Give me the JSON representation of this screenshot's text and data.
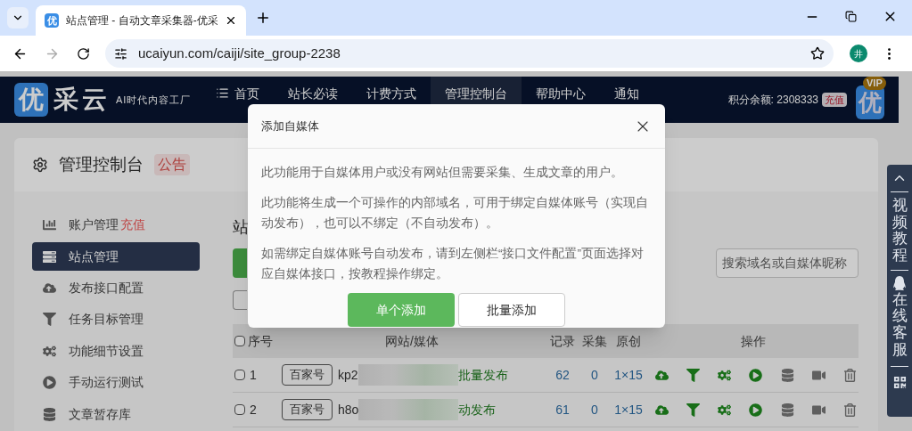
{
  "browser": {
    "tab_title": "站点管理 - 自动文章采集器-优采",
    "url": "ucaiyun.com/caiji/site_group-2238",
    "profile": "井"
  },
  "header": {
    "favicon": "优",
    "logo_mark": "优",
    "logo_text": "采云",
    "slogan": "AI时代内容工厂",
    "nav": [
      {
        "label": "首页",
        "selected": false
      },
      {
        "label": "站长必读",
        "selected": false
      },
      {
        "label": "计费方式",
        "selected": false
      },
      {
        "label": "管理控制台",
        "selected": true
      },
      {
        "label": "帮助中心",
        "selected": false
      },
      {
        "label": "通知",
        "selected": false
      }
    ],
    "balance": "积分余额: 2308333",
    "recharge": "充值",
    "avatar": "优",
    "vip": "VIP"
  },
  "page": {
    "title": "管理控制台",
    "notice": "公告"
  },
  "sidebar": [
    {
      "label": "账户管理",
      "badge": "充值",
      "selected": false
    },
    {
      "label": "站点管理",
      "selected": true
    },
    {
      "label": "发布接口配置",
      "selected": false
    },
    {
      "label": "任务目标管理",
      "selected": false
    },
    {
      "label": "功能细节设置",
      "selected": false
    },
    {
      "label": "手动运行测试",
      "selected": false
    },
    {
      "label": "文章暂存库",
      "selected": false
    }
  ],
  "panel": {
    "heading": "站",
    "search": {
      "placeholder": "搜索域名或自媒体昵称"
    }
  },
  "table": {
    "select_all_checked": false,
    "columns": [
      "序号",
      "网站/媒体",
      "记录",
      "采集",
      "原创",
      "操作"
    ],
    "rows": [
      {
        "checked": false,
        "no": "1",
        "platform": "百家号",
        "domain": "kp2",
        "publish": "批量发布",
        "records": "62",
        "collected": "0",
        "original": "1×15"
      },
      {
        "checked": false,
        "no": "2",
        "platform": "百家号",
        "domain": "h8o",
        "publish": "动发布",
        "records": "61",
        "collected": "0",
        "original": "1×15"
      }
    ]
  },
  "dialog": {
    "title": "添加自媒体",
    "paragraphs": [
      "此功能用于自媒体用户或没有网站但需要采集、生成文章的用户。",
      "此功能将生成一个可操作的内部域名，可用于绑定自媒体账号（实现自动发布），也可以不绑定（不自动发布）。",
      "如需绑定自媒体账号自动发布，请到左侧栏“接口文件配置”页面选择对应自媒体接口，按教程操作绑定。"
    ],
    "buttons": [
      {
        "label": "单个添加",
        "kind": "primary"
      },
      {
        "label": "批量添加",
        "kind": "default"
      }
    ]
  },
  "float_bar": [
    "视频教程",
    "在线客服"
  ]
}
